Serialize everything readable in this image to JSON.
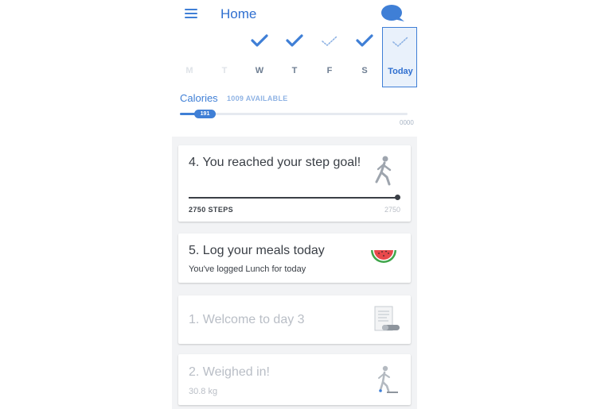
{
  "header": {
    "title": "Home",
    "menu_icon": "hamburger-menu-icon",
    "chat_icon": "chat-bubble-icon"
  },
  "days": [
    {
      "label": "M",
      "state": "empty",
      "faded": true
    },
    {
      "label": "T",
      "state": "empty",
      "faded": true
    },
    {
      "label": "W",
      "state": "check"
    },
    {
      "label": "T",
      "state": "check"
    },
    {
      "label": "F",
      "state": "dotted"
    },
    {
      "label": "S",
      "state": "check"
    },
    {
      "label": "Today",
      "state": "dotted",
      "selected": true
    }
  ],
  "calories": {
    "title": "Calories",
    "available": "1009 AVAILABLE",
    "value": "191",
    "max": "0000",
    "progress": 0.1
  },
  "cards": [
    {
      "title": "4. You reached your step goal!",
      "steps_label": "2750 STEPS",
      "steps_goal": "2750",
      "progress": 1.0,
      "icon": "walking-person-icon"
    },
    {
      "title": "5. Log your meals today",
      "subtitle": "You've logged Lunch for today",
      "icon": "watermelon-icon"
    },
    {
      "title": "1. Welcome to day 3",
      "icon": "document-icon"
    },
    {
      "title": "2. Weighed in!",
      "subtitle": "30.8 kg",
      "icon": "person-on-scale-icon"
    }
  ],
  "colors": {
    "accent": "#3f7fd6",
    "text": "#3a3f46",
    "muted": "#b9bec6"
  }
}
